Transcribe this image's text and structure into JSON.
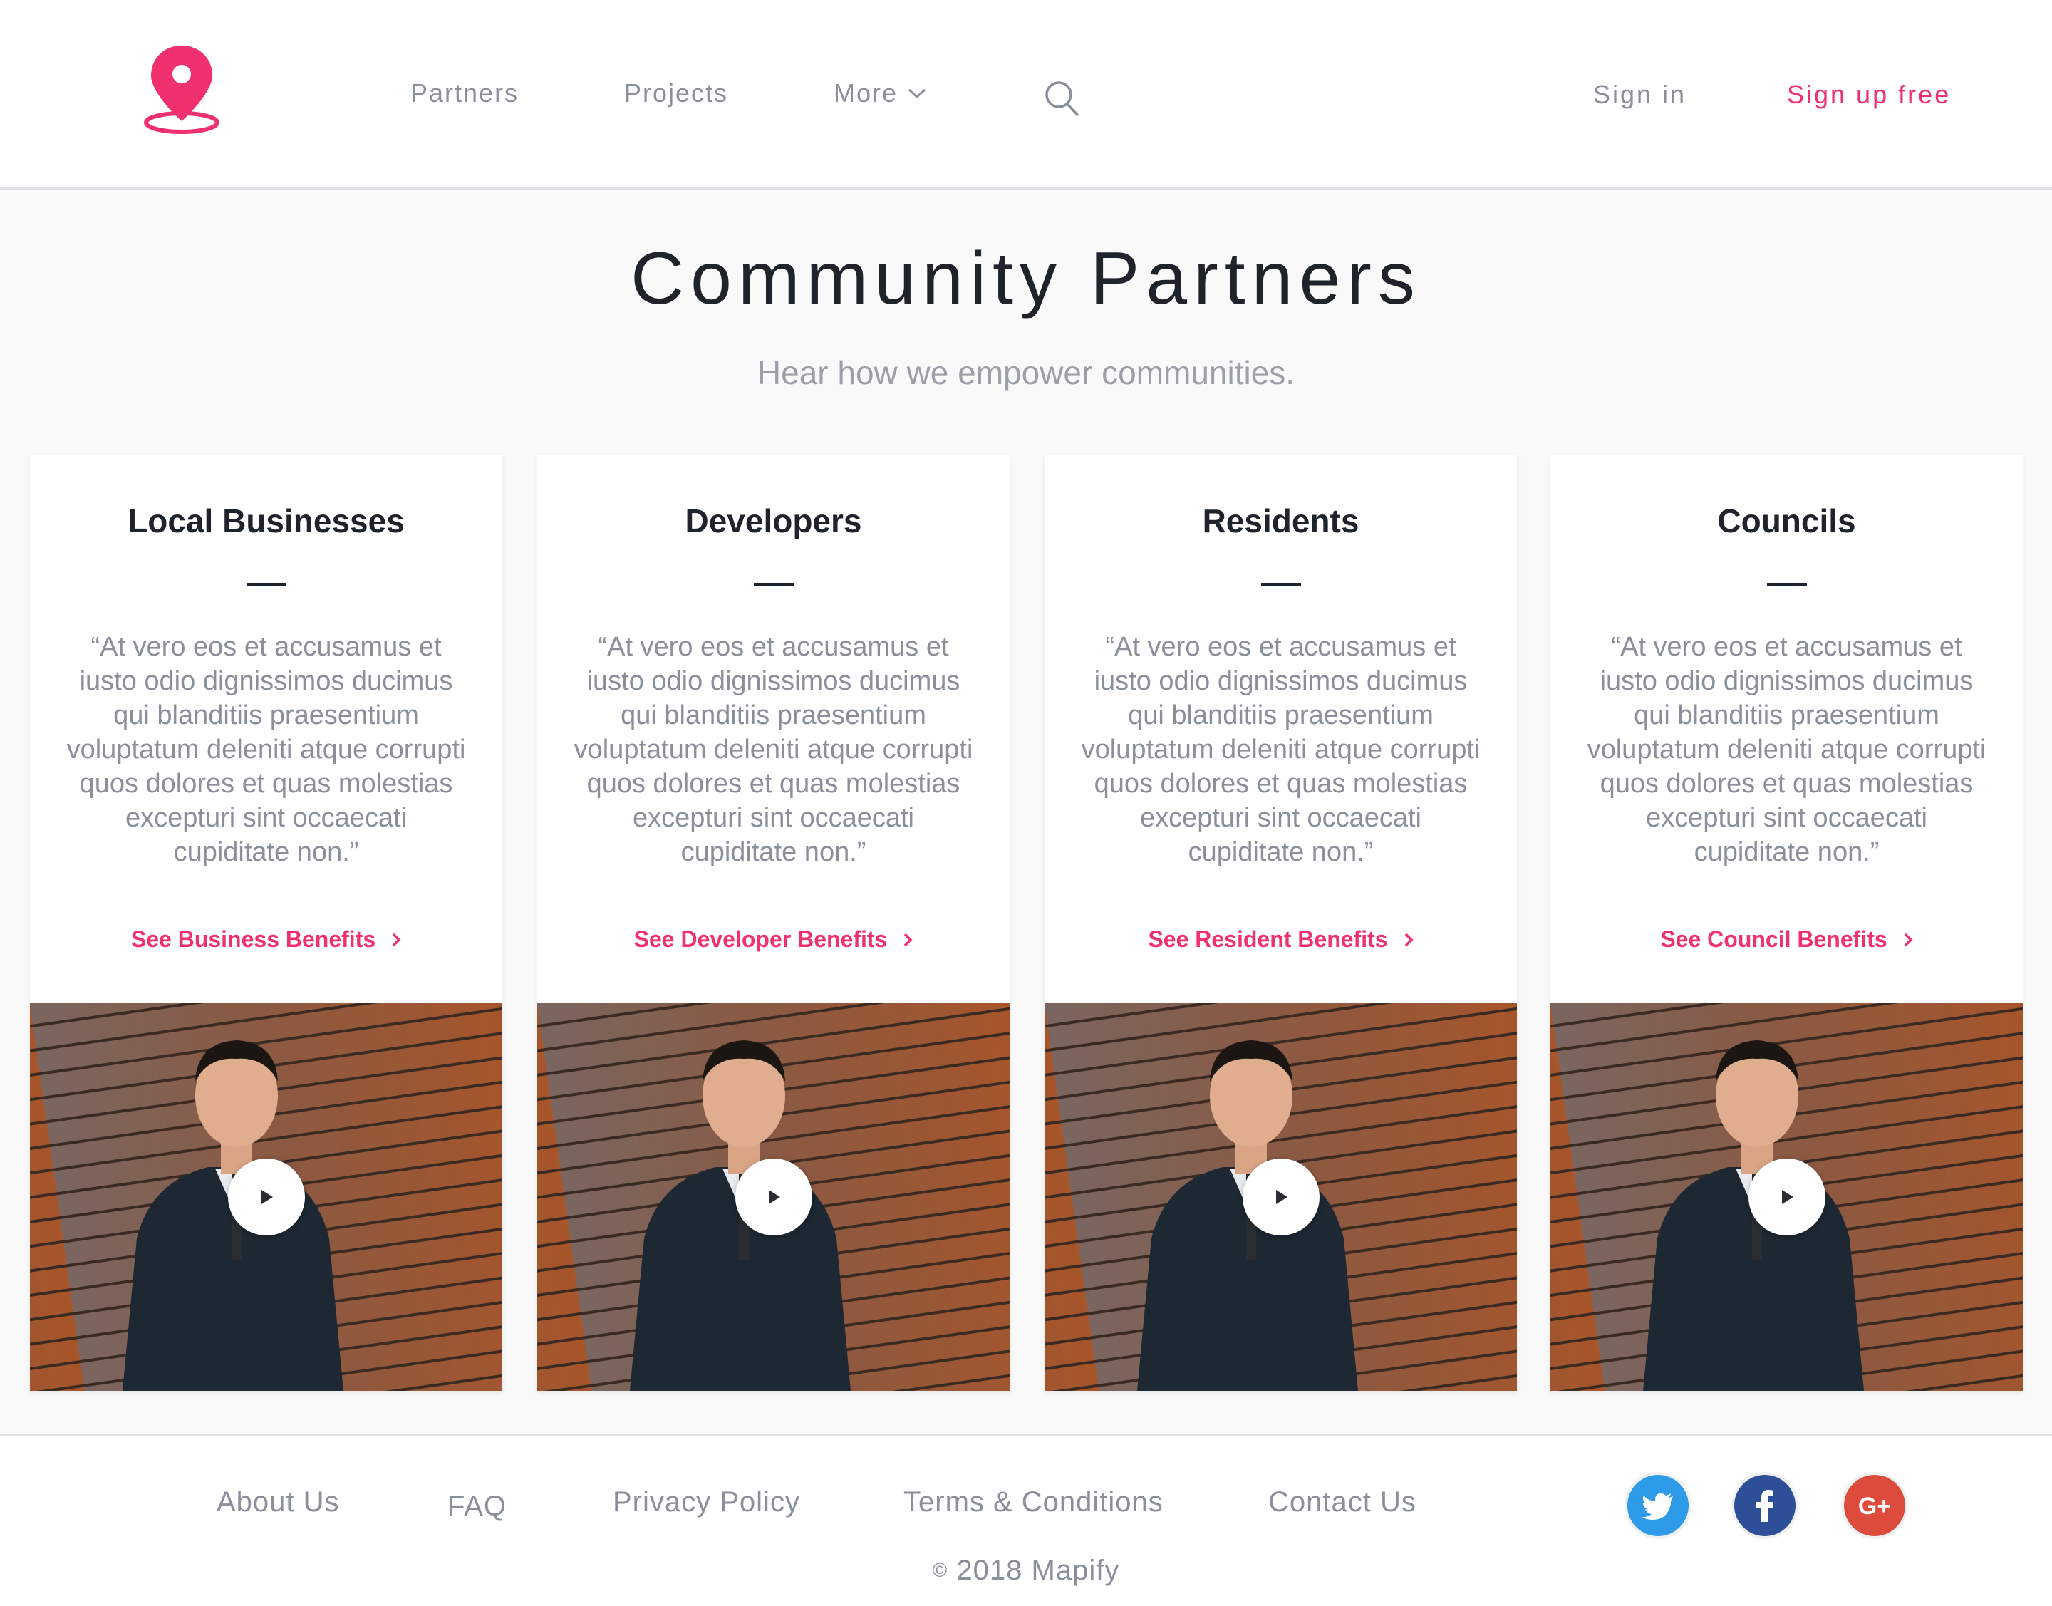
{
  "header": {
    "nav": {
      "partners": "Partners",
      "projects": "Projects",
      "more": "More"
    },
    "sign_in": "Sign in",
    "sign_up": "Sign up free",
    "icons": [
      "map-pin-logo",
      "chevron-down-icon",
      "search-icon"
    ]
  },
  "hero": {
    "title": "Community Partners",
    "subtitle": "Hear how we empower communities."
  },
  "cards": [
    {
      "title": "Local Businesses",
      "quote": "“At vero eos et accusamus et iusto odio dignissimos ducimus qui blanditiis praesentium voluptatum deleniti atque corrupti quos dolores et quas molestias excepturi sint occaecati cupiditate non.”",
      "link": "See Business Benefits"
    },
    {
      "title": "Developers",
      "quote": "“At vero eos et accusamus et iusto odio dignissimos ducimus qui blanditiis praesentium voluptatum deleniti atque corrupti quos dolores et quas molestias excepturi sint occaecati cupiditate non.”",
      "link": "See Developer Benefits"
    },
    {
      "title": "Residents",
      "quote": "“At vero eos et accusamus et iusto odio dignissimos ducimus qui blanditiis praesentium voluptatum deleniti atque corrupti quos dolores et quas molestias excepturi sint occaecati cupiditate non.”",
      "link": "See Resident Benefits"
    },
    {
      "title": "Councils",
      "quote": "“At vero eos et accusamus et iusto odio dignissimos ducimus qui blanditiis praesentium voluptatum deleniti atque corrupti quos dolores et quas molestias excepturi sint occaecati cupiditate non.”",
      "link": "See Council Benefits"
    }
  ],
  "footer": {
    "links": {
      "about": "About Us",
      "faq": "FAQ",
      "privacy": "Privacy Policy",
      "terms": "Terms & Conditions",
      "contact": "Contact Us"
    },
    "social": [
      "twitter-icon",
      "facebook-icon",
      "google-plus-icon"
    ],
    "copyright_symbol": "©",
    "copyright": "2018 Mapify"
  },
  "colors": {
    "accent": "#f0316e",
    "text_dark": "#1f232b",
    "text_muted": "#8a9099",
    "page_bg": "#f9f9f9",
    "twitter": "#2d9be8",
    "facebook": "#2d4f97",
    "google_plus": "#dd4b3d"
  }
}
